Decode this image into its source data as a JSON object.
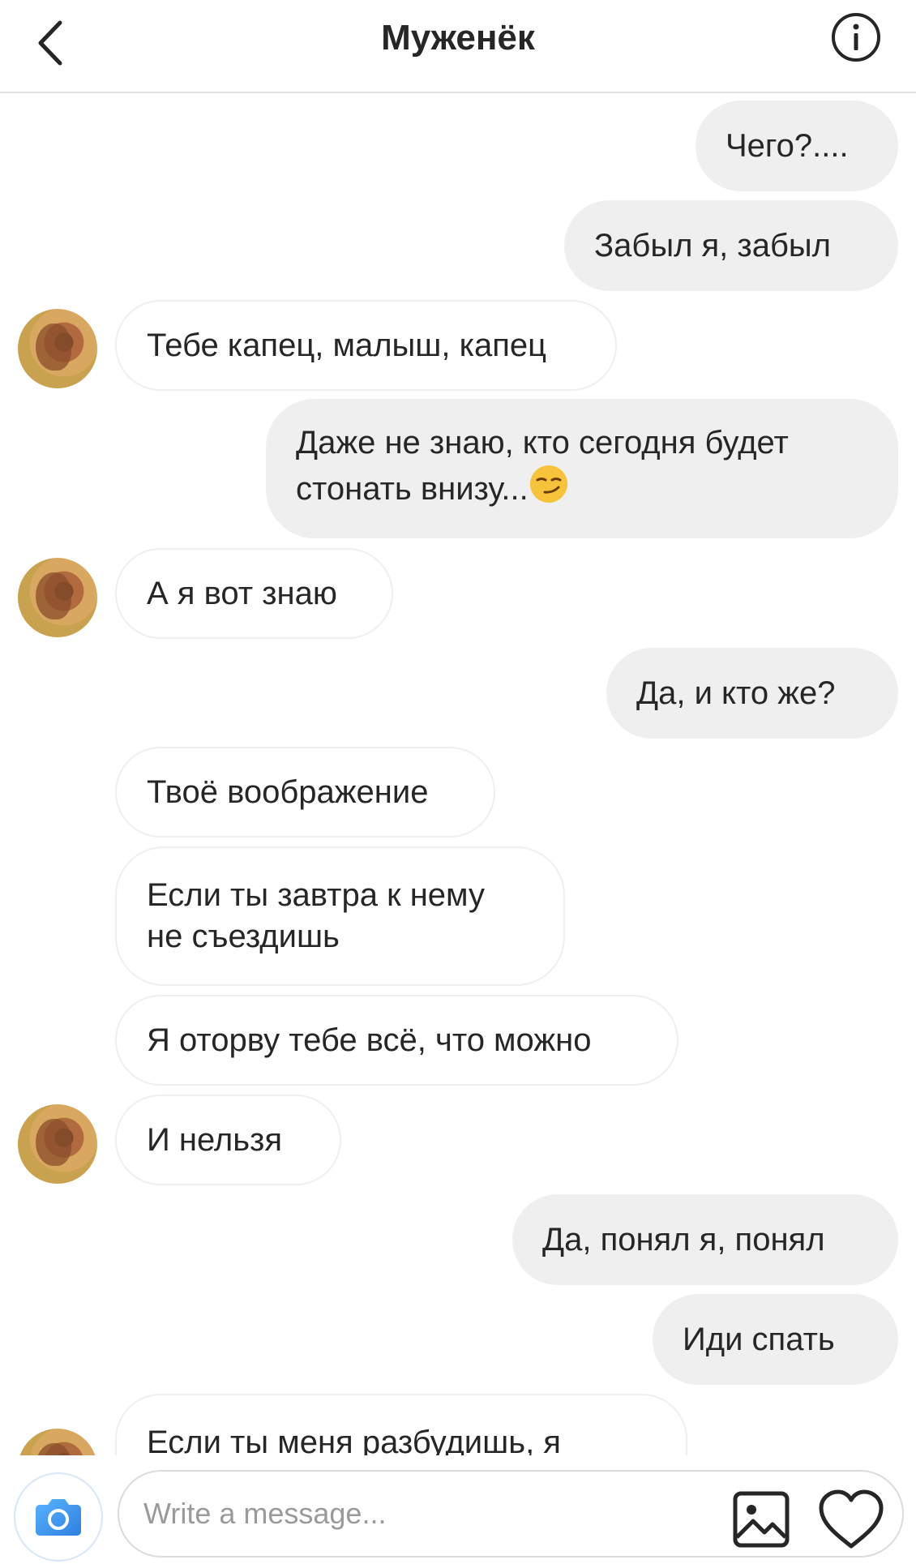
{
  "header": {
    "title": "Муженёк"
  },
  "icons": {
    "back": "chevron-left-icon",
    "info": "info-icon",
    "camera": "camera-icon",
    "gallery": "image-icon",
    "like": "heart-icon"
  },
  "colors": {
    "outgoing_bubble": "#efefef",
    "incoming_border": "#efefef",
    "camera_accent": "#3897f0"
  },
  "messages": [
    {
      "sender": "me",
      "text": "Чего?...."
    },
    {
      "sender": "me",
      "text": "Забыл я, забыл"
    },
    {
      "sender": "him",
      "text": "Тебе капец, малыш, капец"
    },
    {
      "sender": "me",
      "line1": "Даже не знаю, кто сегодня будет",
      "line2": "стонать внизу...",
      "emoji": "😏"
    },
    {
      "sender": "him",
      "text": "А я вот знаю"
    },
    {
      "sender": "me",
      "text": "Да, и кто же?"
    },
    {
      "sender": "him",
      "text": "Твоё воображение"
    },
    {
      "sender": "him",
      "line1": "Если ты завтра к нему",
      "line2": "не съездишь"
    },
    {
      "sender": "him",
      "text": "Я оторву тебе всё, что можно"
    },
    {
      "sender": "him",
      "text": "И нельзя"
    },
    {
      "sender": "me",
      "text": "Да, понял я, понял"
    },
    {
      "sender": "me",
      "text": "Иди спать"
    },
    {
      "sender": "him",
      "text": "Если ты меня разбудишь, я"
    }
  ],
  "composer": {
    "placeholder": "Write a message..."
  }
}
